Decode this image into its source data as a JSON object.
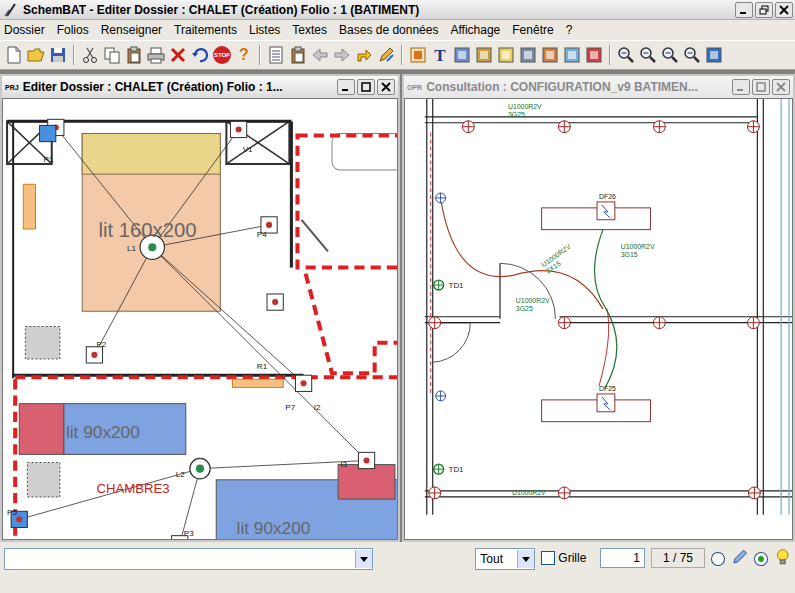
{
  "window": {
    "title": "SchemBAT - Editer  Dossier : CHALET  (Création)  Folio : 1  (BATIMENT)"
  },
  "menu": [
    "Dossier",
    "Folios",
    "Renseigner",
    "Traitements",
    "Listes",
    "Textes",
    "Bases de données",
    "Affichage",
    "Fenêtre",
    "?"
  ],
  "toolbar": {
    "stop": "STOP",
    "help": "?",
    "text_tool": "T"
  },
  "child_windows": [
    {
      "badge": "PRJ",
      "title": "Editer  Dossier : CHALET  (Création)  Folio : 1...",
      "active": true
    },
    {
      "badge": "OPR",
      "title": "Consultation : CONFIGURATION_v9  BATIMEN...",
      "active": false
    }
  ],
  "plan_left": {
    "beds": [
      "lit 160x200",
      "lit 90x200",
      "lit 90x200"
    ],
    "room": "CHAMBRE3",
    "labels": [
      "P1",
      "V1",
      "L1",
      "P4",
      "P2",
      "R1",
      "P7",
      "I2",
      "L2",
      "I3",
      "P3",
      "P5"
    ]
  },
  "plan_right": {
    "cables": [
      {
        "lines": [
          "U1000R2V",
          "3G25"
        ]
      },
      {
        "lines": [
          "U1000R2V",
          "2X15"
        ]
      },
      {
        "lines": [
          "U1000R2V",
          "3G15"
        ]
      },
      {
        "lines": [
          "U1000R2V",
          "3G25"
        ]
      },
      {
        "lines": [
          "U1000R2V"
        ]
      }
    ],
    "panels": [
      "DF26",
      "DF25"
    ],
    "boards": [
      "TD1",
      "TD1"
    ]
  },
  "status_bar": {
    "field": "",
    "filter": "Tout",
    "grid": {
      "label": "Grille",
      "checked": false
    },
    "page": "1",
    "pages": "1 / 75",
    "modes": [
      {
        "selected": false
      },
      {
        "selected": true
      }
    ]
  }
}
